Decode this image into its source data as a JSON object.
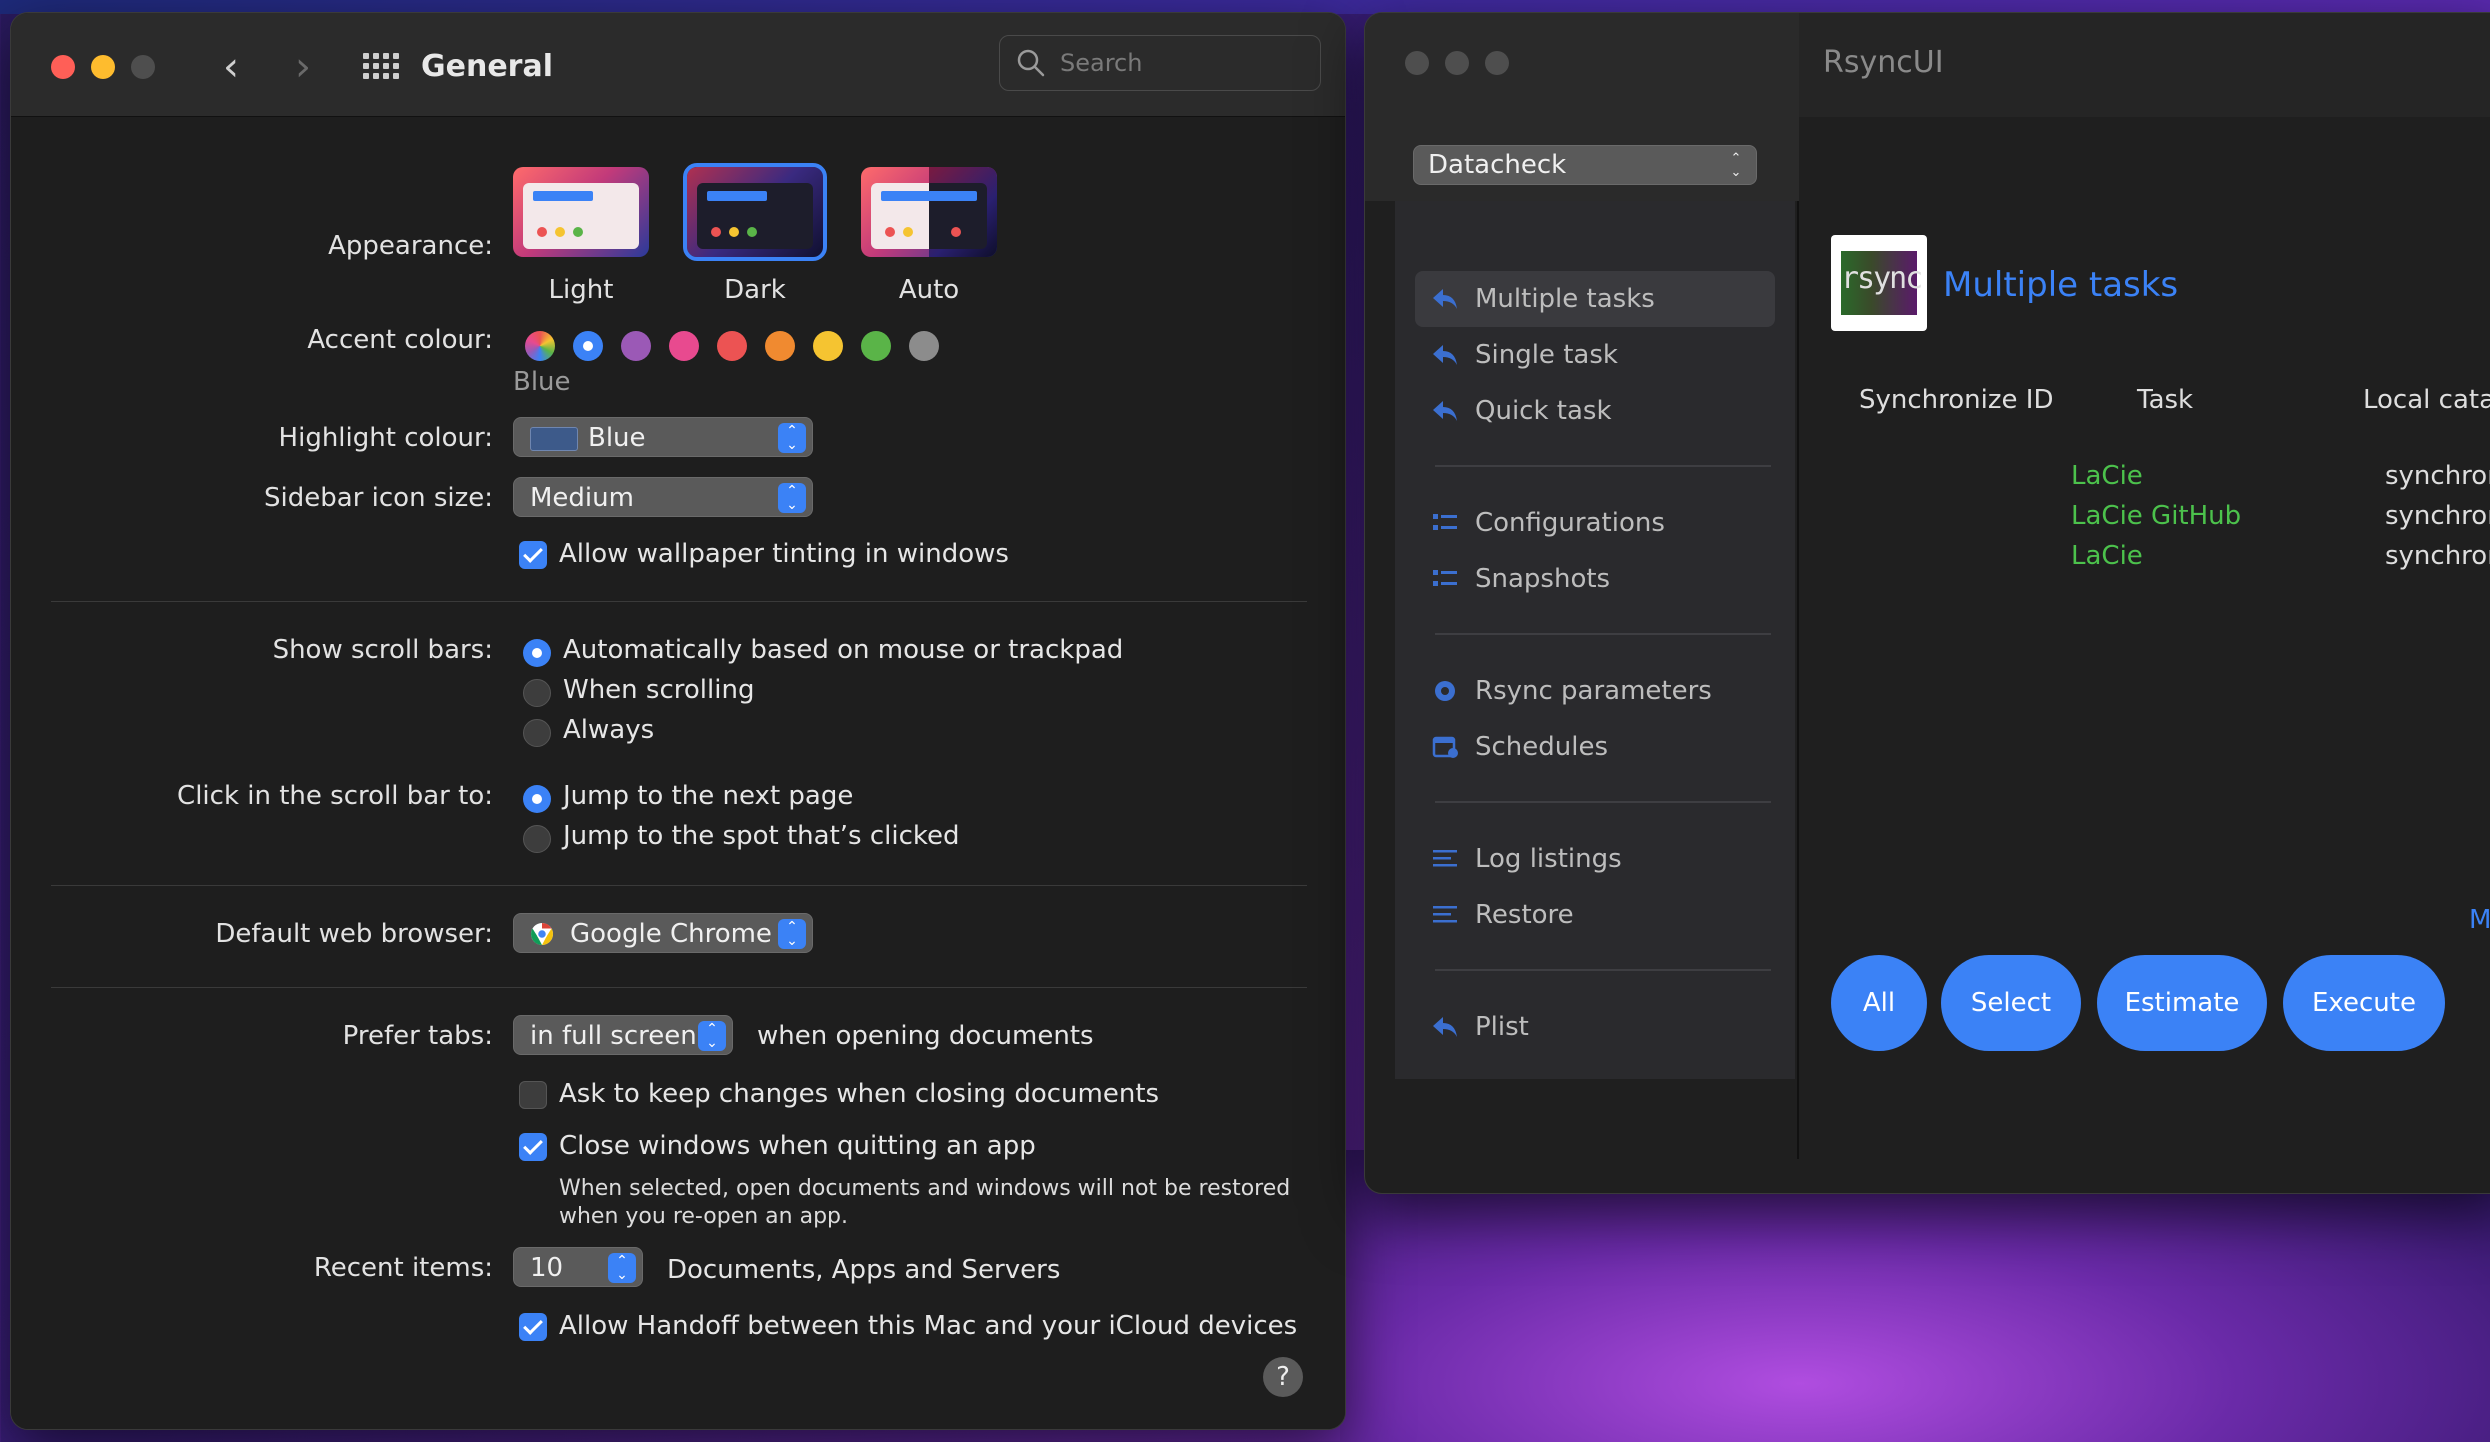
{
  "colors": {
    "accent": "#3b82f6",
    "task_green": "#4cc24c"
  },
  "settings": {
    "title": "General",
    "search_placeholder": "Search",
    "appearance": {
      "label": "Appearance:",
      "options": [
        "Light",
        "Dark",
        "Auto"
      ],
      "selected": "Dark"
    },
    "accent": {
      "label": "Accent colour:",
      "colors": [
        "multicolor",
        "#3b82f6",
        "#9b59b6",
        "#e84a8f",
        "#ec5353",
        "#f08a30",
        "#f5c431",
        "#5ab448",
        "#8c8c8c"
      ],
      "selected_index": 1,
      "selected_name": "Blue"
    },
    "highlight": {
      "label": "Highlight colour:",
      "value": "Blue"
    },
    "sidebar_icon_size": {
      "label": "Sidebar icon size:",
      "value": "Medium"
    },
    "wallpaper_tinting": {
      "label": "Allow wallpaper tinting in windows",
      "checked": true
    },
    "scroll_bars": {
      "label": "Show scroll bars:",
      "options": [
        "Automatically based on mouse or trackpad",
        "When scrolling",
        "Always"
      ],
      "selected_index": 0
    },
    "click_scroll": {
      "label": "Click in the scroll bar to:",
      "options": [
        "Jump to the next page",
        "Jump to the spot that’s clicked"
      ],
      "selected_index": 0
    },
    "browser": {
      "label": "Default web browser:",
      "value": "Google Chrome"
    },
    "prefer_tabs": {
      "label": "Prefer tabs:",
      "value": "in full screen",
      "suffix": "when opening documents"
    },
    "ask_keep_changes": {
      "label": "Ask to keep changes when closing documents",
      "checked": false
    },
    "close_windows": {
      "label": "Close windows when quitting an app",
      "checked": true,
      "note_line1": "When selected, open documents and windows will not be restored",
      "note_line2": "when you re-open an app."
    },
    "recent_items": {
      "label": "Recent items:",
      "value": "10",
      "suffix": "Documents, Apps and Servers"
    },
    "handoff": {
      "label": "Allow Handoff between this Mac and your iCloud devices",
      "checked": true
    },
    "help": "?"
  },
  "rsync": {
    "title": "RsyncUI",
    "profile": "Datacheck",
    "sidebar": [
      {
        "label": "Multiple tasks",
        "active": true
      },
      {
        "label": "Single task"
      },
      {
        "label": "Quick task"
      },
      {
        "label": "Configurations"
      },
      {
        "label": "Snapshots"
      },
      {
        "label": "Rsync parameters"
      },
      {
        "label": "Schedules"
      },
      {
        "label": "Log listings"
      },
      {
        "label": "Restore"
      },
      {
        "label": "Plist"
      }
    ],
    "logo_text": "rsync",
    "heading": "Multiple tasks",
    "columns": [
      "Synchronize ID",
      "Task",
      "Local catal"
    ],
    "rows": [
      {
        "task": "LaCie",
        "local": "synchror"
      },
      {
        "task": "LaCie GitHub",
        "local": "synchror"
      },
      {
        "task": "LaCie",
        "local": "synchror"
      }
    ],
    "truncated_link": "M",
    "buttons": [
      "All",
      "Select",
      "Estimate",
      "Execute"
    ]
  }
}
